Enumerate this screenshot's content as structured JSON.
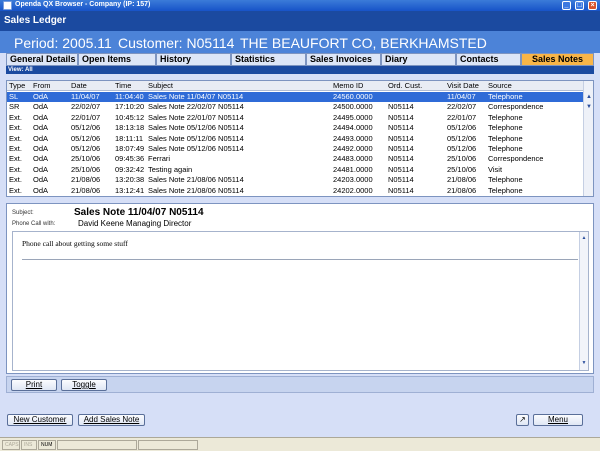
{
  "window": {
    "title": "Openda QX Browser  -  Company (IP: 157)",
    "controls": [
      "_",
      "□",
      "×"
    ]
  },
  "app": {
    "header": "Sales Ledger",
    "period_label": "Period: 2005.11",
    "customer_label": "Customer: N05114",
    "customer_name": "THE BEAUFORT CO, BERKHAMSTED"
  },
  "tabs": [
    {
      "label": "General Details",
      "active": false
    },
    {
      "label": "Open Items",
      "active": false
    },
    {
      "label": "History",
      "active": false
    },
    {
      "label": "Statistics",
      "active": false
    },
    {
      "label": "Sales Invoices",
      "active": false
    },
    {
      "label": "Diary",
      "active": false
    },
    {
      "label": "Contacts",
      "active": false
    },
    {
      "label": "Sales Notes",
      "active": true
    }
  ],
  "view": {
    "label": "View: All"
  },
  "table": {
    "columns": [
      "Type",
      "From",
      "Date",
      "Time",
      "Subject",
      "Memo ID",
      "Ord. Cust.",
      "Visit Date",
      "Source"
    ],
    "rows": [
      [
        "SL",
        "OdA",
        "11/04/07",
        "11:04:40",
        "Sales Note 11/04/07 N05114",
        "24560.0000",
        "",
        "11/04/07",
        "Telephone"
      ],
      [
        "SR",
        "OdA",
        "22/02/07",
        "17:10:20",
        "Sales Note 22/02/07 N05114",
        "24500.0000",
        "N05114",
        "22/02/07",
        "Correspondence"
      ],
      [
        "Ext.",
        "OdA",
        "22/01/07",
        "10:45:12",
        "Sales Note 22/01/07 N05114",
        "24495.0000",
        "N05114",
        "22/01/07",
        "Telephone"
      ],
      [
        "Ext.",
        "OdA",
        "05/12/06",
        "18:13:18",
        "Sales Note 05/12/06 N05114",
        "24494.0000",
        "N05114",
        "05/12/06",
        "Telephone"
      ],
      [
        "Ext.",
        "OdA",
        "05/12/06",
        "18:11:11",
        "Sales Note 05/12/06 N05114",
        "24493.0000",
        "N05114",
        "05/12/06",
        "Telephone"
      ],
      [
        "Ext.",
        "OdA",
        "05/12/06",
        "18:07:49",
        "Sales Note 05/12/06 N05114",
        "24492.0000",
        "N05114",
        "05/12/06",
        "Telephone"
      ],
      [
        "Ext.",
        "OdA",
        "25/10/06",
        "09:45:36",
        "Ferrari",
        "24483.0000",
        "N05114",
        "25/10/06",
        "Correspondence"
      ],
      [
        "Ext.",
        "OdA",
        "25/10/06",
        "09:32:42",
        "Testing again",
        "24481.0000",
        "N05114",
        "25/10/06",
        "Visit"
      ],
      [
        "Ext.",
        "OdA",
        "21/08/06",
        "13:20:38",
        "Sales Note 21/08/06 N05114",
        "24203.0000",
        "N05114",
        "21/08/06",
        "Telephone"
      ],
      [
        "Ext.",
        "OdA",
        "21/08/06",
        "13:12:41",
        "Sales Note 21/08/06 N05114",
        "24202.0000",
        "N05114",
        "21/08/06",
        "Telephone"
      ]
    ],
    "selected_row": 0
  },
  "detail": {
    "subject_label": "Subject:",
    "subject": "Sales Note 11/04/07 N05114",
    "phone_label": "Phone Call with:",
    "phone_with": "David Keene Managing Director",
    "note": "Phone call about getting some stuff"
  },
  "buttons": {
    "print": "Print",
    "toggle": "Toggle",
    "new_customer": "New Customer",
    "add_sales_note": "Add Sales Note",
    "menu": "Menu"
  },
  "statusbar": {
    "caps": "CAPS",
    "ins": "INS",
    "num": "NUM"
  },
  "colors": {
    "header_bg": "#1b4aa0",
    "info_bg": "#4c83d8",
    "active_tab": "#f8b548",
    "selected_row": "#2f6bd7"
  }
}
